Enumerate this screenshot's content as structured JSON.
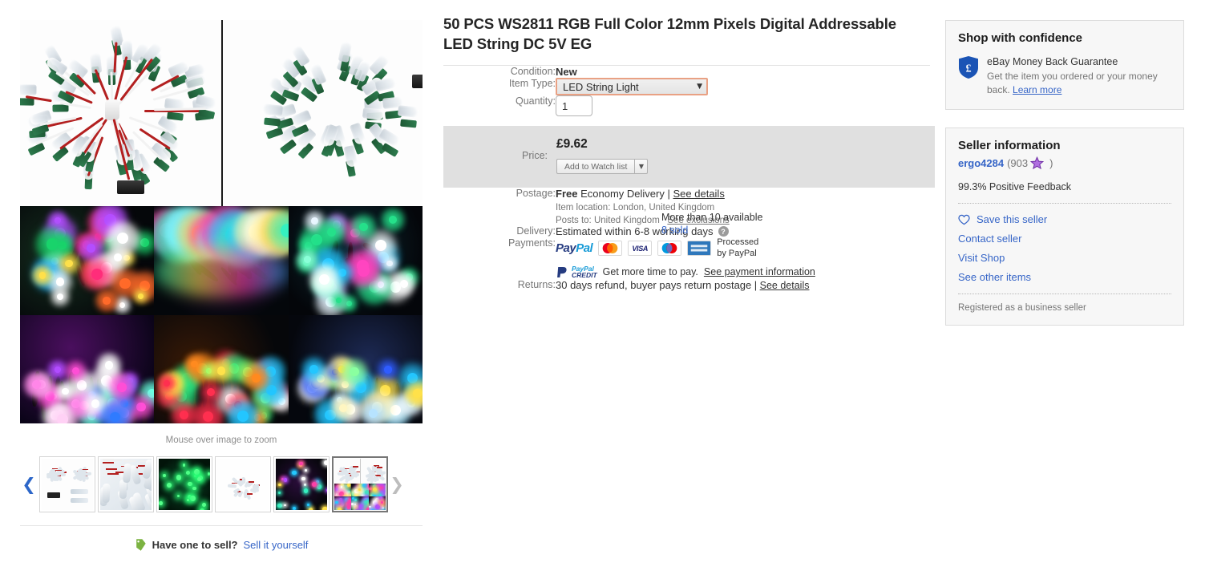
{
  "gallery": {
    "zoom_hint": "Mouse over image to zoom",
    "prev_arrow": "chevron-left-icon",
    "next_arrow": "chevron-right-icon",
    "thumb_count": 6,
    "selected_thumb_index": 6,
    "have_one_to_sell": "Have one to sell?",
    "sell_it_yourself": "Sell it yourself"
  },
  "item": {
    "title": "50 PCS WS2811 RGB Full Color 12mm Pixels Digital Addressable LED String DC 5V EG",
    "condition_label": "Condition:",
    "condition_value": "New",
    "item_type_label": "Item Type:",
    "item_type_value": "LED String Light",
    "quantity_label": "Quantity:",
    "quantity_value": "1",
    "availability": "More than 10 available",
    "sold": "8 sold",
    "price_label": "Price:",
    "price_value": "£9.62",
    "watch_button": "Add to Watch list",
    "watch_caret": "chevron-down-icon",
    "postage_label": "Postage:",
    "postage_free": "Free",
    "postage_service": "Economy Delivery",
    "postage_sep": "|",
    "postage_see_details": "See details",
    "item_location_label": "Item location:",
    "item_location_value": "London, United Kingdom",
    "posts_to_label": "Posts to:",
    "posts_to_value": "United Kingdom",
    "see_exclusions": "See exclusions",
    "delivery_label": "Delivery:",
    "delivery_value": "Estimated within 6-8 working days",
    "delivery_help": "?",
    "payments_label": "Payments:",
    "paypal_logo_a": "Pay",
    "paypal_logo_b": "Pal",
    "card_mastercard": "MasterCard",
    "card_visa": "VISA",
    "card_maestro": "Maestro",
    "card_amex": "AMERICAN EXPRESS",
    "processed_l1": "Processed",
    "processed_l2": "by PayPal",
    "ppcredit_l1": "PayPal",
    "ppcredit_l2": "CREDIT",
    "pay_note": "Get more time to pay.",
    "see_payment_information": "See payment information",
    "returns_label": "Returns:",
    "returns_value": "30 days refund, buyer pays return postage",
    "returns_sep": "|",
    "returns_see_details": "See details"
  },
  "confidence": {
    "heading": "Shop with confidence",
    "badge_icon": "shield-pound-icon",
    "mbg_title": "eBay Money Back Guarantee",
    "mbg_text": "Get the item you ordered or your money back.",
    "learn_more": "Learn more"
  },
  "seller": {
    "heading": "Seller information",
    "name": "ergo4284",
    "score": "(903",
    "star_icon": "purple-star-icon",
    "score_close": ")",
    "feedback": "99.3% Positive Feedback",
    "links": [
      {
        "label": "Save this seller",
        "icon": "heart-icon"
      },
      {
        "label": "Contact seller",
        "icon": ""
      },
      {
        "label": "Visit Shop",
        "icon": ""
      },
      {
        "label": "See other items",
        "icon": ""
      }
    ],
    "registered_note": "Registered as a business seller"
  },
  "colors": {
    "link_blue": "#3665c7",
    "price_band": "#e0e0e0",
    "select_border": "#e9a184",
    "panel_bg": "#f7f7f7",
    "star_purple": "#9b59d0",
    "shield_blue": "#1b54b5",
    "tag_green": "#7cb342"
  }
}
